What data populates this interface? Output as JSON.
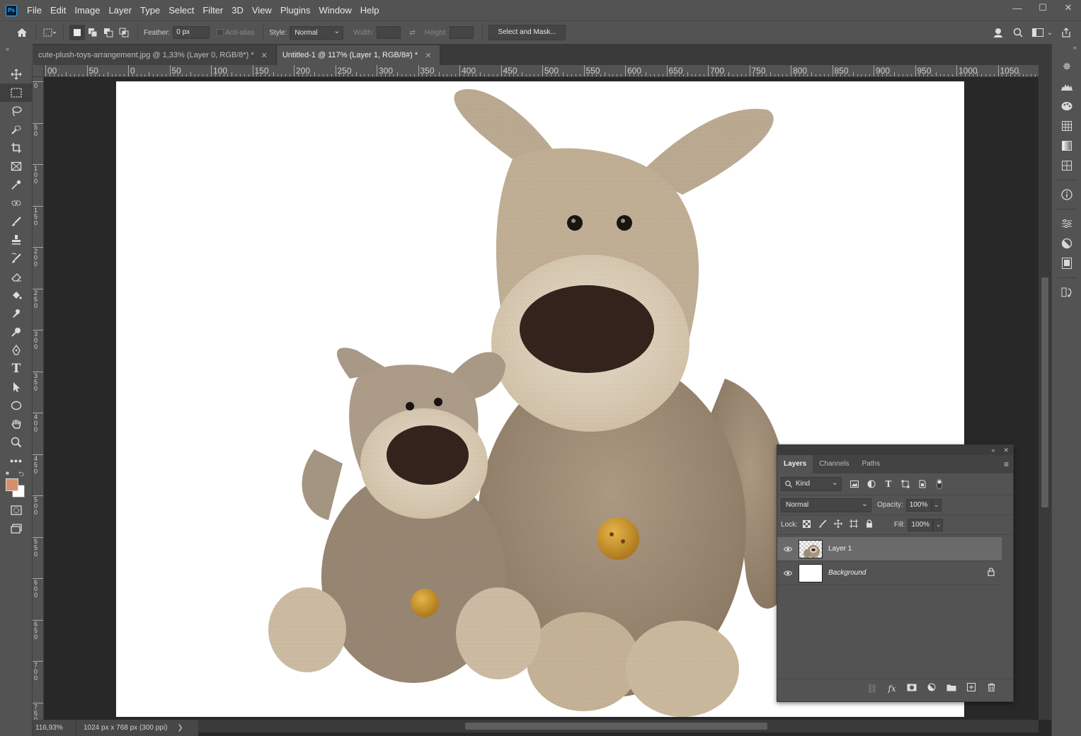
{
  "app": {
    "logo": "Ps",
    "menu": [
      "File",
      "Edit",
      "Image",
      "Layer",
      "Type",
      "Select",
      "Filter",
      "3D",
      "View",
      "Plugins",
      "Window",
      "Help"
    ],
    "window_controls": {
      "minimize": "—",
      "maximize": "☐",
      "close": "✕"
    }
  },
  "options": {
    "feather_label": "Feather:",
    "feather_value": "0 px",
    "antialias_label": "Anti-alias",
    "style_label": "Style:",
    "style_value": "Normal",
    "width_label": "Width:",
    "height_label": "Height:",
    "select_mask_label": "Select and Mask..."
  },
  "tabs": [
    {
      "label": "cute-plush-toys-arrangement.jpg @ 1,33% (Layer 0, RGB/8*) *",
      "active": false
    },
    {
      "label": "Untitled-1 @ 117% (Layer 1, RGB/8#) *",
      "active": true
    }
  ],
  "ruler": {
    "h_labels": [
      "00",
      "50",
      "0",
      "50",
      "100",
      "150",
      "200",
      "250",
      "300",
      "350",
      "400",
      "450",
      "500",
      "550",
      "600",
      "650",
      "700",
      "750",
      "800",
      "850",
      "900",
      "950",
      "1000",
      "1050",
      "11"
    ],
    "v_labels": [
      "0",
      "50",
      "100",
      "150",
      "200",
      "250",
      "300",
      "350",
      "400",
      "450",
      "500",
      "550",
      "600",
      "650",
      "700",
      "750"
    ]
  },
  "status": {
    "zoom": "116,93%",
    "doc_info": "1024 px x 768 px (300 ppi)",
    "arrow": "❯"
  },
  "layers_panel": {
    "tabs": [
      "Layers",
      "Channels",
      "Paths"
    ],
    "filter_kind": "Kind",
    "blend_mode": "Normal",
    "opacity_label": "Opacity:",
    "opacity_value": "100%",
    "lock_label": "Lock:",
    "fill_label": "Fill:",
    "fill_value": "100%",
    "layers": [
      {
        "name": "Layer 1",
        "selected": true,
        "locked": false
      },
      {
        "name": "Background",
        "selected": false,
        "locked": true
      }
    ]
  },
  "colors": {
    "foreground": "#d4906c",
    "background": "#ffffff"
  }
}
